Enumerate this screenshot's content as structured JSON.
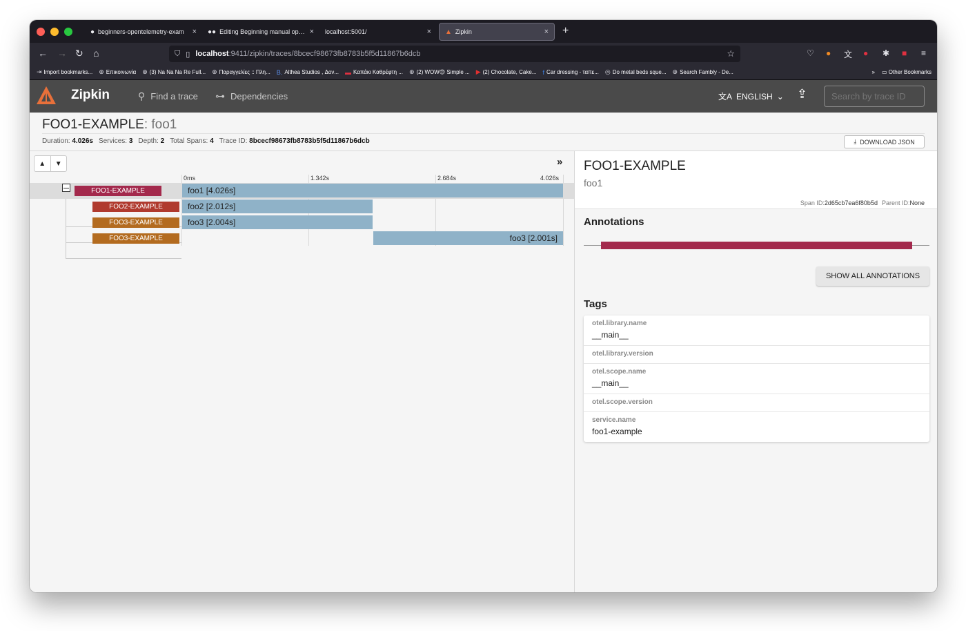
{
  "browser": {
    "tabs": [
      {
        "title": "beginners-opentelemetry-exam",
        "icon": "github-icon"
      },
      {
        "title": "Editing Beginning manual open",
        "icon": "medium-icon"
      },
      {
        "title": "localhost:5001/",
        "icon": ""
      },
      {
        "title": "Zipkin",
        "icon": "zipkin-icon"
      }
    ],
    "url_host": "localhost",
    "url_path": ":9411/zipkin/traces/8bcecf98673fb8783b5f5d11867b6dcb",
    "bookmarks": [
      "Import bookmarks...",
      "Επικοινωνία",
      "(3) Na Na Na Re Full...",
      "Παραγγελίες :: Πλη...",
      "Althea Studios , Δον...",
      "Καπάκι Καθρέφτη ...",
      "(2) WOW😊 Simple ...",
      "(2) Chocolate, Cake...",
      "Car dressing - ταπε...",
      "Do metal beds sque...",
      "Search Fambly - De..."
    ],
    "other_bookmarks": "Other Bookmarks"
  },
  "zipkin": {
    "brand": "Zipkin",
    "nav_find": "Find a trace",
    "nav_deps": "Dependencies",
    "language": "ENGLISH",
    "search_placeholder": "Search by trace ID"
  },
  "trace": {
    "service": "FOO1-EXAMPLE",
    "span_name": ": foo1",
    "duration_label": "Duration:",
    "duration": "4.026s",
    "services_label": "Services:",
    "services": "3",
    "depth_label": "Depth:",
    "depth": "2",
    "total_spans_label": "Total Spans:",
    "total_spans": "4",
    "trace_id_label": "Trace ID:",
    "trace_id": "8bcecf98673fb8783b5f5d11867b6dcb",
    "download_label": "DOWNLOAD JSON"
  },
  "timeline": {
    "ticks": [
      "0ms",
      "1.342s",
      "2.684s",
      "4.026s"
    ],
    "spans": [
      {
        "service": "FOO1-EXAMPLE",
        "label": "foo1 [4.026s]",
        "color": "#a3294c"
      },
      {
        "service": "FOO2-EXAMPLE",
        "label": "foo2 [2.012s]",
        "color": "#b03a2e"
      },
      {
        "service": "FOO3-EXAMPLE",
        "label": "foo3 [2.004s]",
        "color": "#b36b1f"
      },
      {
        "service": "FOO3-EXAMPLE",
        "label": "foo3 [2.001s]",
        "color": "#b36b1f"
      }
    ]
  },
  "detail": {
    "service": "FOO1-EXAMPLE",
    "span": "foo1",
    "span_id_label": "Span ID:",
    "span_id": "2d65cb7ea6f80b5d",
    "parent_id_label": "Parent ID:",
    "parent_id": "None",
    "annotations_title": "Annotations",
    "show_all": "SHOW ALL ANNOTATIONS",
    "tags_title": "Tags",
    "tags": [
      {
        "key": "otel.library.name",
        "value": "__main__"
      },
      {
        "key": "otel.library.version",
        "value": ""
      },
      {
        "key": "otel.scope.name",
        "value": "__main__"
      },
      {
        "key": "otel.scope.version",
        "value": ""
      },
      {
        "key": "service.name",
        "value": "foo1-example"
      }
    ]
  },
  "colors": {
    "annotation_bar": "#a3294c",
    "span_bar": "#8fb2c8",
    "header": "#4a4a4a"
  }
}
